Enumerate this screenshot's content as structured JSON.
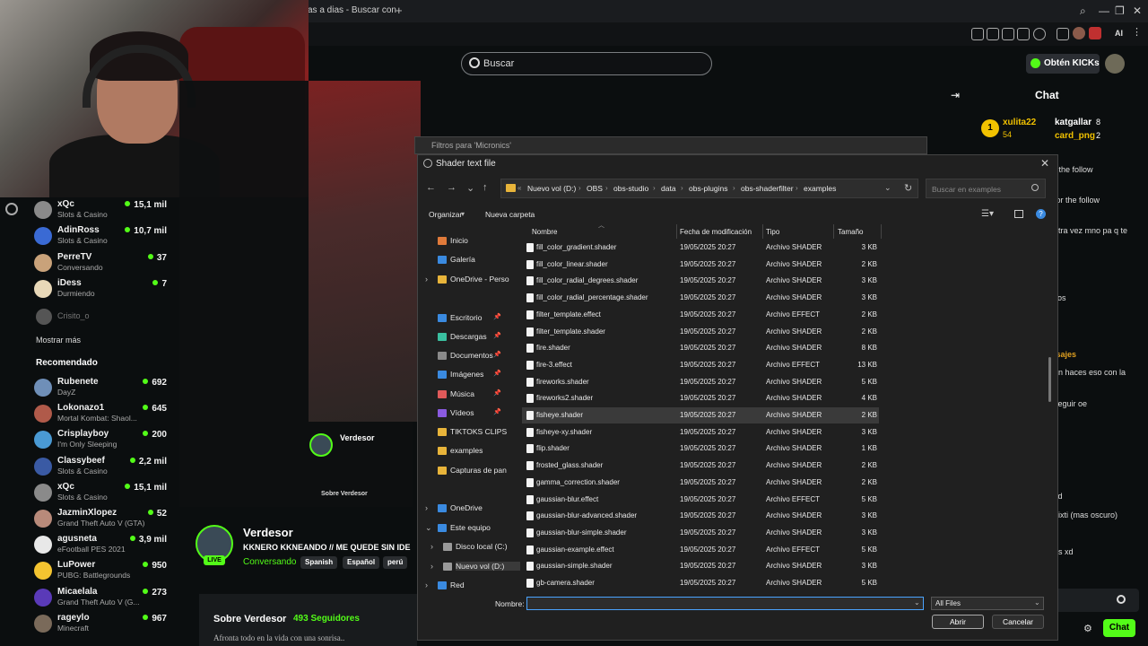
{
  "browser": {
    "tab_title": "as a dias - Buscar con",
    "new_tab": "+",
    "ai_label": "AI"
  },
  "kick": {
    "search_placeholder": "Buscar",
    "kicks_button": "Obtén KICKs",
    "chat_title": "Chat",
    "chat_button": "Chat"
  },
  "sidebar": {
    "top_items": [
      {
        "name": "xQc",
        "category": "Slots & Casino",
        "viewers": "15,1 mil",
        "color": "#8a8a8a"
      },
      {
        "name": "AdinRoss",
        "category": "Slots & Casino",
        "viewers": "10,7 mil",
        "color": "#3a6ad4"
      },
      {
        "name": "PerreTV",
        "category": "Conversando",
        "viewers": "37",
        "color": "#c9a27a"
      },
      {
        "name": "iDess",
        "category": "Durmiendo",
        "viewers": "7",
        "color": "#e8d8b8"
      }
    ],
    "offline_item": "Crisito_o",
    "show_more": "Mostrar más",
    "recommended_header": "Recomendado",
    "recommended": [
      {
        "name": "Rubenete",
        "category": "DayZ",
        "viewers": "692",
        "color": "#6f8fb8"
      },
      {
        "name": "Lokonazo1",
        "category": "Mortal Kombat: Shaol...",
        "viewers": "645",
        "color": "#b05a4a"
      },
      {
        "name": "Crisplayboy",
        "category": "I'm Only Sleeping",
        "viewers": "200",
        "color": "#4a9ad4"
      },
      {
        "name": "Classybeef",
        "category": "Slots & Casino",
        "viewers": "2,2 mil",
        "color": "#3a5aa4"
      },
      {
        "name": "xQc",
        "category": "Slots & Casino",
        "viewers": "15,1 mil",
        "color": "#8a8a8a"
      },
      {
        "name": "JazminXlopez",
        "category": "Grand Theft Auto V (GTA)",
        "viewers": "52",
        "color": "#b88a7a"
      },
      {
        "name": "agusneta",
        "category": "eFootball PES 2021",
        "viewers": "3,9 mil",
        "color": "#e8e8e8"
      },
      {
        "name": "LuPower",
        "category": "PUBG: Battlegrounds",
        "viewers": "950",
        "color": "#f4c430"
      },
      {
        "name": "Micaelala",
        "category": "Grand Theft Auto V (G...",
        "viewers": "273",
        "color": "#5a3ab8"
      },
      {
        "name": "rageylo",
        "category": "Minecraft",
        "viewers": "967",
        "color": "#7a6a5a"
      }
    ]
  },
  "stream": {
    "streamer": "Verdesor",
    "title": "KKNERO KKNEANDO // ME QUEDE SIN IDE",
    "category": "Conversando",
    "tags": [
      "Spanish",
      "Español",
      "perú"
    ],
    "live": "LIVE",
    "about_title": "Sobre Verdesor",
    "followers": "493 Seguidores",
    "about_desc": "Afronta todo en la vida con una sonrisa.."
  },
  "chat": {
    "top1_name": "xulita22",
    "top1_count": "54",
    "top2_name": "katgallar",
    "top2_count": "8",
    "top3_name": "card_png",
    "top3_count": "2",
    "lines": [
      "r the follow",
      "for the follow",
      "otra vez mno pa q te",
      "ijos",
      "nsajes",
      "on haces eso con la",
      "seguir oe",
      "xd",
      "nixti (mas oscuro)",
      "as xd"
    ]
  },
  "filter_dialog": {
    "title": "Filtros para 'Micronics'"
  },
  "file_dialog": {
    "title": "Shader text file",
    "breadcrumb": [
      "Nuevo vol (D:)",
      "OBS",
      "obs-studio",
      "data",
      "obs-plugins",
      "obs-shaderfilter",
      "examples"
    ],
    "search_placeholder": "Buscar en examples",
    "organize": "Organizar",
    "new_folder": "Nueva carpeta",
    "columns": {
      "name": "Nombre",
      "modified": "Fecha de modificación",
      "type": "Tipo",
      "size": "Tamaño"
    },
    "nav_items": [
      {
        "label": "Inicio",
        "color": "#e07a3a"
      },
      {
        "label": "Galería",
        "color": "#3a8ae0"
      },
      {
        "label": "OneDrive - Perso",
        "color": "#e8b43a"
      },
      {
        "label": "Escritorio",
        "color": "#3a8ae0"
      },
      {
        "label": "Descargas",
        "color": "#3ac0a0"
      },
      {
        "label": "Documentos",
        "color": "#8a8a8a"
      },
      {
        "label": "Imágenes",
        "color": "#3a8ae0"
      },
      {
        "label": "Música",
        "color": "#e05a5a"
      },
      {
        "label": "Vídeos",
        "color": "#8a5ae0"
      },
      {
        "label": "TIKTOKS CLIPS",
        "color": "#e8b43a"
      },
      {
        "label": "examples",
        "color": "#e8b43a"
      },
      {
        "label": "Capturas de pan",
        "color": "#e8b43a"
      },
      {
        "label": "OneDrive",
        "color": "#3a8ae0"
      },
      {
        "label": "Este equipo",
        "color": "#3a8ae0"
      },
      {
        "label": "Disco local (C:)",
        "color": "#9a9a9a"
      },
      {
        "label": "Nuevo vol (D:)",
        "color": "#9a9a9a"
      },
      {
        "label": "Red",
        "color": "#3a8ae0"
      }
    ],
    "files": [
      {
        "name": "fill_color_gradient.shader",
        "date": "19/05/2025 20:27",
        "type": "Archivo SHADER",
        "size": "3 KB"
      },
      {
        "name": "fill_color_linear.shader",
        "date": "19/05/2025 20:27",
        "type": "Archivo SHADER",
        "size": "2 KB"
      },
      {
        "name": "fill_color_radial_degrees.shader",
        "date": "19/05/2025 20:27",
        "type": "Archivo SHADER",
        "size": "3 KB"
      },
      {
        "name": "fill_color_radial_percentage.shader",
        "date": "19/05/2025 20:27",
        "type": "Archivo SHADER",
        "size": "3 KB"
      },
      {
        "name": "filter_template.effect",
        "date": "19/05/2025 20:27",
        "type": "Archivo EFFECT",
        "size": "2 KB"
      },
      {
        "name": "filter_template.shader",
        "date": "19/05/2025 20:27",
        "type": "Archivo SHADER",
        "size": "2 KB"
      },
      {
        "name": "fire.shader",
        "date": "19/05/2025 20:27",
        "type": "Archivo SHADER",
        "size": "8 KB"
      },
      {
        "name": "fire-3.effect",
        "date": "19/05/2025 20:27",
        "type": "Archivo EFFECT",
        "size": "13 KB"
      },
      {
        "name": "fireworks.shader",
        "date": "19/05/2025 20:27",
        "type": "Archivo SHADER",
        "size": "5 KB"
      },
      {
        "name": "fireworks2.shader",
        "date": "19/05/2025 20:27",
        "type": "Archivo SHADER",
        "size": "4 KB"
      },
      {
        "name": "fisheye.shader",
        "date": "19/05/2025 20:27",
        "type": "Archivo SHADER",
        "size": "2 KB",
        "selected": true
      },
      {
        "name": "fisheye-xy.shader",
        "date": "19/05/2025 20:27",
        "type": "Archivo SHADER",
        "size": "3 KB"
      },
      {
        "name": "flip.shader",
        "date": "19/05/2025 20:27",
        "type": "Archivo SHADER",
        "size": "1 KB"
      },
      {
        "name": "frosted_glass.shader",
        "date": "19/05/2025 20:27",
        "type": "Archivo SHADER",
        "size": "2 KB"
      },
      {
        "name": "gamma_correction.shader",
        "date": "19/05/2025 20:27",
        "type": "Archivo SHADER",
        "size": "2 KB"
      },
      {
        "name": "gaussian-blur.effect",
        "date": "19/05/2025 20:27",
        "type": "Archivo EFFECT",
        "size": "5 KB"
      },
      {
        "name": "gaussian-blur-advanced.shader",
        "date": "19/05/2025 20:27",
        "type": "Archivo SHADER",
        "size": "3 KB"
      },
      {
        "name": "gaussian-blur-simple.shader",
        "date": "19/05/2025 20:27",
        "type": "Archivo SHADER",
        "size": "3 KB"
      },
      {
        "name": "gaussian-example.effect",
        "date": "19/05/2025 20:27",
        "type": "Archivo EFFECT",
        "size": "5 KB"
      },
      {
        "name": "gaussian-simple.shader",
        "date": "19/05/2025 20:27",
        "type": "Archivo SHADER",
        "size": "3 KB"
      },
      {
        "name": "gb-camera.shader",
        "date": "19/05/2025 20:27",
        "type": "Archivo SHADER",
        "size": "5 KB"
      }
    ],
    "filename_label": "Nombre:",
    "filename_value": "",
    "file_type": "All Files",
    "open_button": "Abrir",
    "cancel_button": "Cancelar"
  }
}
